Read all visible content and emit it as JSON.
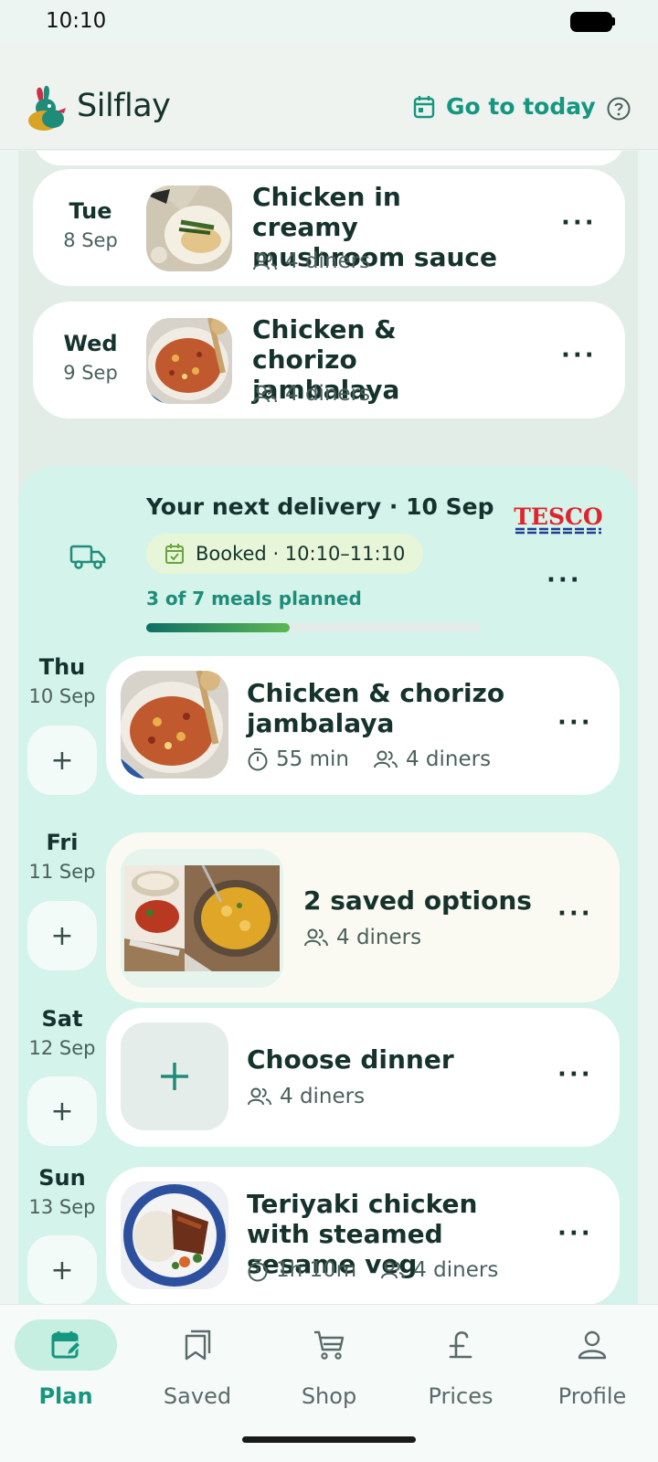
{
  "status_bar": {
    "time": "10:10"
  },
  "header": {
    "app_name": "Silflay",
    "go_to_today": "Go to today"
  },
  "earlier_meals": [
    {
      "day": "Tue",
      "date": "8 Sep",
      "title": "Chicken in creamy mushroom sauce",
      "diners": "4 diners"
    },
    {
      "day": "Wed",
      "date": "9 Sep",
      "title": "Chicken & chorizo jambalaya",
      "diners": "4 diners"
    }
  ],
  "delivery": {
    "title": "Your next delivery · 10 Sep",
    "booked": "Booked · 10:10–11:10",
    "retailer": "TESCO",
    "meals_planned": "3 of 7 meals planned",
    "progress_fraction": 0.43
  },
  "planned_meals": [
    {
      "day": "Thu",
      "date": "10 Sep",
      "title": "Chicken & chorizo jambalaya",
      "time": "55 min",
      "diners": "4 diners"
    },
    {
      "day": "Fri",
      "date": "11 Sep",
      "title": "2 saved options",
      "diners": "4 diners"
    },
    {
      "day": "Sat",
      "date": "12 Sep",
      "title": "Choose dinner",
      "diners": "4 diners"
    },
    {
      "day": "Sun",
      "date": "13 Sep",
      "title": "Teriyaki chicken with steamed sesame veg",
      "time": "1h 10m",
      "diners": "4 diners"
    }
  ],
  "nav": {
    "plan": "Plan",
    "saved": "Saved",
    "shop": "Shop",
    "prices": "Prices",
    "profile": "Profile"
  },
  "colors": {
    "accent": "#15967f",
    "delivery_bg": "#d4f3ea",
    "tesco_red": "#e1232b",
    "tesco_blue": "#1b3e95"
  }
}
